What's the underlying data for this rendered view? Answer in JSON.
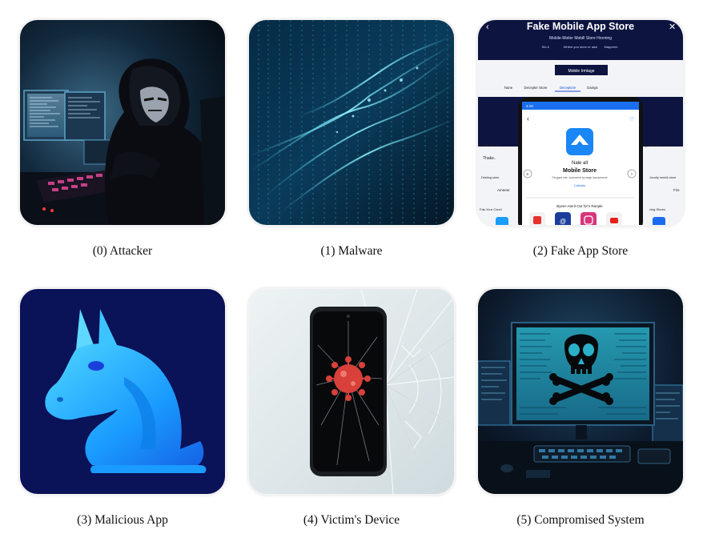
{
  "items": [
    {
      "caption": "(0) Attacker"
    },
    {
      "caption": "(1) Malware"
    },
    {
      "caption": "(2) Fake App Store",
      "scene": {
        "title": "Fake Mobile App Store",
        "subtitle": "Mobile-Moiler Mobill Store Hroming",
        "tag_a": "Sto-ll",
        "tag_b": "Whitre-you store er aas!",
        "tag_c": "Mapprere",
        "cta": "Mobile Irmtage",
        "tab_a": "Nane",
        "tab_b": "Decepter Store",
        "tab_c": "Decepticte",
        "tab_d": "Daings",
        "phone_time": "4:16",
        "app_name_a": "Nale all",
        "app_name_b": "Mobile Store",
        "app_desc": "Ferygee wib. Iconmerid by eage kampenone",
        "app_link": "Callnain",
        "phone_section": "Byeer-Aterit Out for's Ranple",
        "side_left_a": "Aumoun S",
        "side_left_b": "Thake..",
        "side_left_c": "Deeling store",
        "side_left_d": "Amnenr",
        "side_left_e": "Fak-Your Conel",
        "side_right_a": "ngh Store",
        "side_right_b": "Jocolty mninik store",
        "side_right_c": "Firs",
        "side_right_d": "ving Stores"
      }
    },
    {
      "caption": "(3) Malicious App"
    },
    {
      "caption": "(4) Victim's Device"
    },
    {
      "caption": "(5) Compromised System"
    }
  ],
  "colors": {
    "caption_text": "#111111",
    "tile_border": "#f3f3f3",
    "attacker_bg": "#0b1a2a",
    "malware_bg": "#06233b",
    "store_bg": "#0b1640",
    "horse_bg": "#0a1258",
    "horse_fill": "#1aa8ff",
    "device_bg": "#dfe7ea",
    "virus": "#d8403a",
    "system_bg": "#0d1b2e",
    "skull_screen": "#2ab0c8"
  }
}
